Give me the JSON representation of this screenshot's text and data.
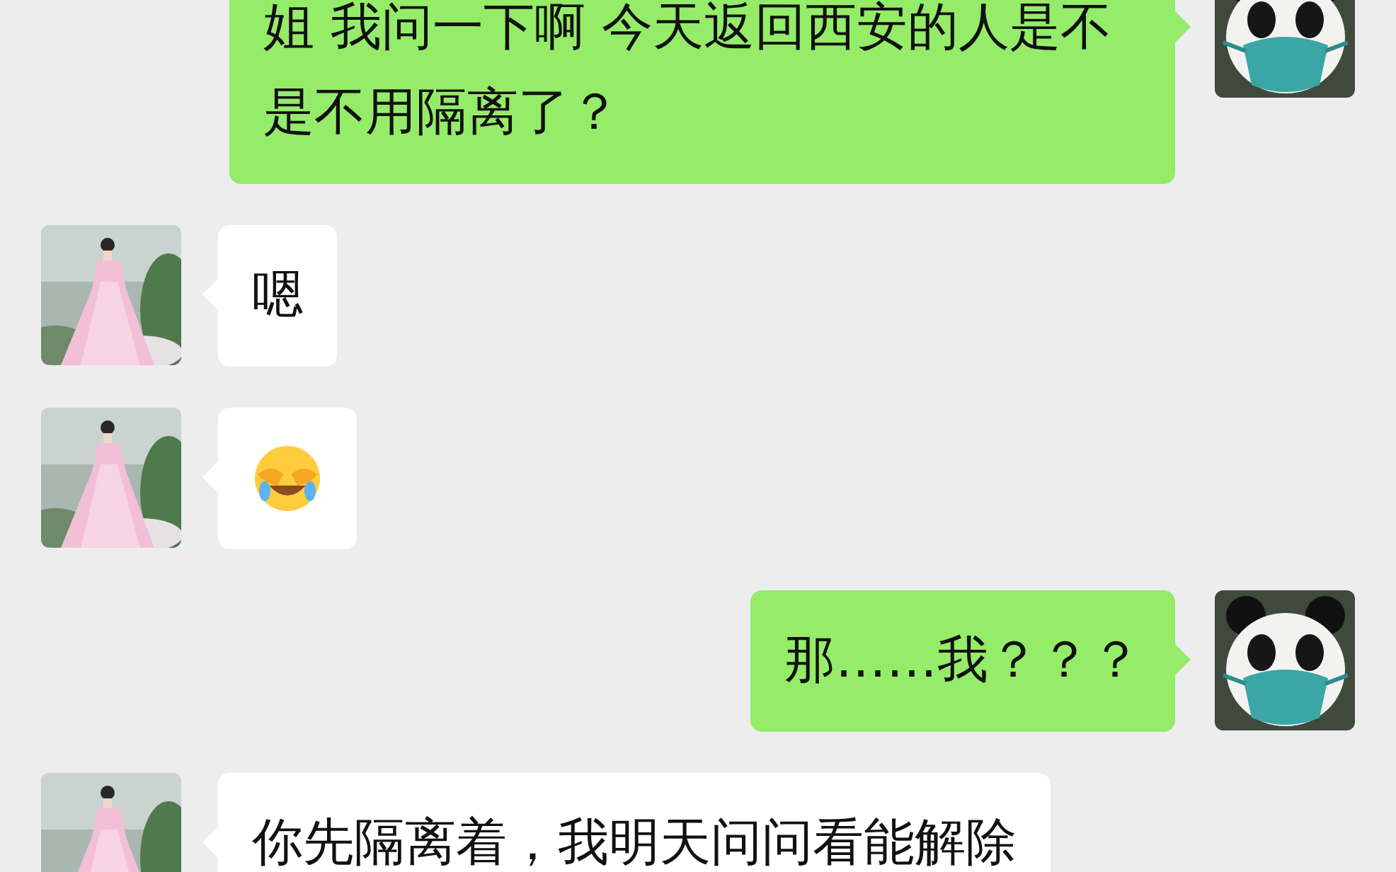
{
  "messages": [
    {
      "outgoing": true,
      "kind": "text",
      "text": "姐 我问一下啊 今天返回西安的人是不是不用隔离了？"
    },
    {
      "outgoing": false,
      "kind": "text",
      "text": "嗯"
    },
    {
      "outgoing": false,
      "kind": "emoji"
    },
    {
      "outgoing": true,
      "kind": "text",
      "text": "那……我？？？"
    },
    {
      "outgoing": false,
      "kind": "text",
      "text": "你先隔离着，我明天问问看能解除"
    }
  ]
}
